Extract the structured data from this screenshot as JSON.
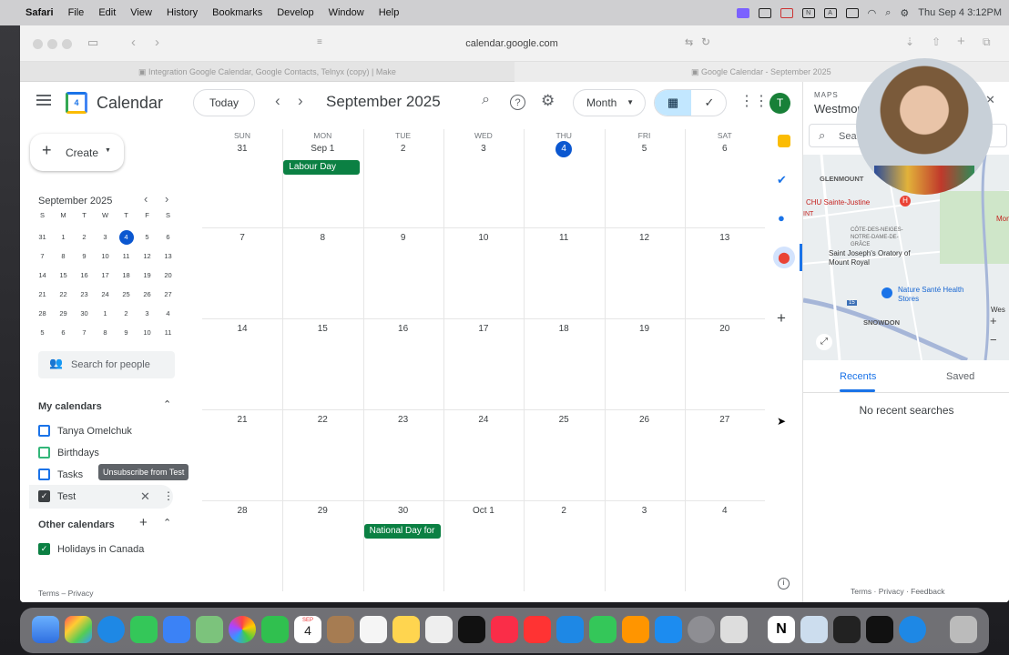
{
  "menubar": {
    "app": "Safari",
    "items": [
      "File",
      "Edit",
      "View",
      "History",
      "Bookmarks",
      "Develop",
      "Window",
      "Help"
    ],
    "clock": "Thu Sep 4  3:12PM"
  },
  "browser": {
    "url": "calendar.google.com",
    "tab1": "Integration Google Calendar, Google Contacts, Telnyx (copy) | Make",
    "tab2": "Google Calendar - September 2025"
  },
  "gcal": {
    "app_name": "Calendar",
    "today_button": "Today",
    "current_month": "September 2025",
    "view_select": "Month",
    "avatar_letter": "T",
    "create_label": "Create",
    "mini": {
      "title": "September 2025",
      "weekday_heads": [
        "S",
        "M",
        "T",
        "W",
        "T",
        "F",
        "S"
      ],
      "weeks": [
        [
          "31",
          "1",
          "2",
          "3",
          "4",
          "5",
          "6"
        ],
        [
          "7",
          "8",
          "9",
          "10",
          "11",
          "12",
          "13"
        ],
        [
          "14",
          "15",
          "16",
          "17",
          "18",
          "19",
          "20"
        ],
        [
          "21",
          "22",
          "23",
          "24",
          "25",
          "26",
          "27"
        ],
        [
          "28",
          "29",
          "30",
          "1",
          "2",
          "3",
          "4"
        ],
        [
          "5",
          "6",
          "7",
          "8",
          "9",
          "10",
          "11"
        ]
      ]
    },
    "search_people": "Search for people",
    "my_calendars_title": "My calendars",
    "my_calendars": [
      "Tanya Omelchuk",
      "Birthdays",
      "Tasks",
      "Test"
    ],
    "tooltip": "Unsubscribe from Test",
    "other_calendars_title": "Other calendars",
    "other_calendars": [
      "Holidays in Canada"
    ],
    "footer": "Terms – Privacy",
    "weekday_heads": [
      "SUN",
      "MON",
      "TUE",
      "WED",
      "THU",
      "FRI",
      "SAT"
    ],
    "weeks": [
      [
        "31",
        "Sep 1",
        "2",
        "3",
        "4",
        "5",
        "6"
      ],
      [
        "7",
        "8",
        "9",
        "10",
        "11",
        "12",
        "13"
      ],
      [
        "14",
        "15",
        "16",
        "17",
        "18",
        "19",
        "20"
      ],
      [
        "21",
        "22",
        "23",
        "24",
        "25",
        "26",
        "27"
      ],
      [
        "28",
        "29",
        "30",
        "Oct 1",
        "2",
        "3",
        "4"
      ]
    ],
    "events": {
      "labour_day": "Labour Day",
      "national_day": "National Day for"
    }
  },
  "maps": {
    "label": "MAPS",
    "title": "Westmou",
    "search_placeholder": "Sea",
    "map_labels": [
      "GLENMOUNT",
      "CHU Sainte-Justine",
      "CÔTE-DES-NEIGES-NOTRE-DAME-DE-GRÂCE",
      "Saint Joseph's Oratory of Mount Royal",
      "Nature Santé Health Stores",
      "SNOWDON",
      "INT",
      "Mon",
      "Wes",
      "15"
    ],
    "tab_recents": "Recents",
    "tab_saved": "Saved",
    "empty": "No recent searches",
    "footer": [
      "Terms",
      "Privacy",
      "Feedback"
    ]
  },
  "dock": {
    "calendar_month": "SEP",
    "calendar_day": "4"
  },
  "colors": {
    "accent": "#1a73e8",
    "event_green": "#0b8043",
    "avatar_green": "#188038"
  }
}
